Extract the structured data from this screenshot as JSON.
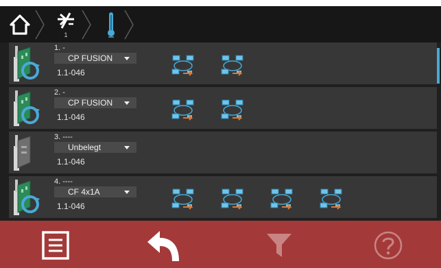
{
  "breadcrumb": {
    "items": [
      {
        "icon": "home-icon"
      },
      {
        "icon": "controller-off-icon",
        "sub": "1"
      },
      {
        "icon": "thermometer-icon"
      }
    ]
  },
  "rows": [
    {
      "number": "1. -",
      "selection": "CP FUSION",
      "version": "1.1-046",
      "card": "network-card-icon",
      "ports": [
        "network-ring-icon",
        "network-ring-icon"
      ]
    },
    {
      "number": "2. -",
      "selection": "CP FUSION",
      "version": "1.1-046",
      "card": "network-card-icon",
      "ports": [
        "network-ring-icon",
        "network-ring-icon"
      ]
    },
    {
      "number": "3. ----",
      "selection": "Unbelegt",
      "version": "1.1-046",
      "card": "empty-card-icon",
      "ports": []
    },
    {
      "number": "4. ----",
      "selection": "CF 4x1A",
      "version": "1.1-046",
      "card": "network-card-icon",
      "ports": [
        "network-ring-icon",
        "network-ring-icon",
        "network-ring-icon",
        "network-ring-icon"
      ]
    }
  ],
  "footer": {
    "buttons": [
      {
        "icon": "menu-list-icon"
      },
      {
        "icon": "back-arrow-icon"
      },
      {
        "icon": "filter-icon",
        "state": "disabled"
      },
      {
        "icon": "help-icon",
        "state": "disabled"
      }
    ]
  },
  "colors": {
    "screen_bg": "#1f1f1f",
    "row_bg": "#373737",
    "footer_bg": "#a33a39",
    "accent_blue": "#49a9d6",
    "card_green": "#2d8a59",
    "arrow_orange": "#e2782f"
  }
}
